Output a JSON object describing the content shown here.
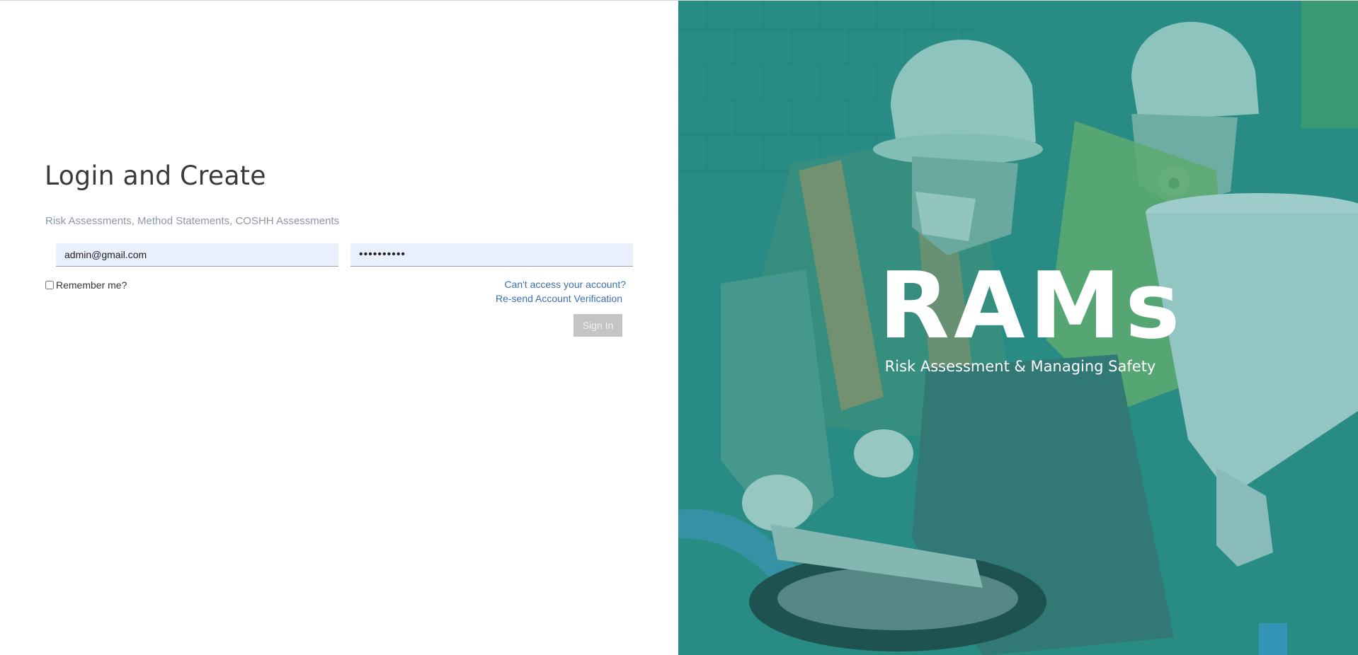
{
  "login": {
    "title": "Login and Create",
    "subtitle": "Risk Assessments, Method Statements, COSHH Assessments",
    "email_value": "admin@gmail.com",
    "password_value": "••••••••••",
    "remember_label": "Remember me?",
    "cant_access_link": "Can't access your account?",
    "resend_link": "Re-send Account Verification",
    "signin_label": "Sign In"
  },
  "hero": {
    "brand_name": "RAMs",
    "tagline": "Risk Assessment & Managing Safety",
    "image_description": "construction-workers-hardhats",
    "overlay_color": "#2a8c86"
  },
  "colors": {
    "link": "#3b6fb0",
    "input_bg": "#e8f0fe",
    "button_disabled": "#c4c4c4",
    "subtitle": "#8d98a6"
  }
}
